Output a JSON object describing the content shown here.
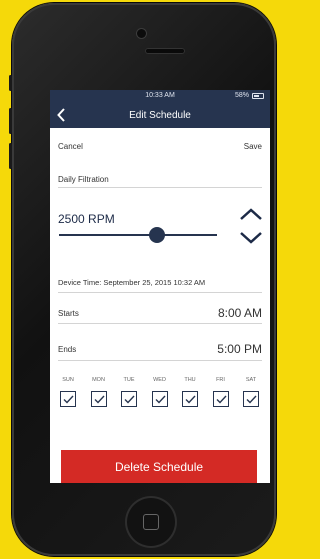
{
  "status_bar": {
    "time": "10:33 AM",
    "battery": "58%"
  },
  "nav": {
    "title": "Edit Schedule"
  },
  "actions": {
    "cancel": "Cancel",
    "save": "Save"
  },
  "schedule_name": "Daily Filtration",
  "speed": {
    "value": "2500 RPM",
    "level": 0.62
  },
  "device_time": "Device Time: September 25, 2015 10:32 AM",
  "starts": {
    "label": "Starts",
    "value": "8:00 AM"
  },
  "ends": {
    "label": "Ends",
    "value": "5:00 PM"
  },
  "days": [
    {
      "label": "SUN",
      "checked": true
    },
    {
      "label": "MON",
      "checked": true
    },
    {
      "label": "TUE",
      "checked": true
    },
    {
      "label": "WED",
      "checked": true
    },
    {
      "label": "THU",
      "checked": true
    },
    {
      "label": "FRI",
      "checked": true
    },
    {
      "label": "SAT",
      "checked": true
    }
  ],
  "delete_label": "Delete Schedule",
  "colors": {
    "nav": "#26344f",
    "delete": "#d42a25",
    "background": "#f5d90a"
  },
  "icons": [
    "back-chevron-icon",
    "chevron-up-icon",
    "chevron-down-icon",
    "checkmark-icon",
    "battery-icon",
    "home-button-icon"
  ]
}
